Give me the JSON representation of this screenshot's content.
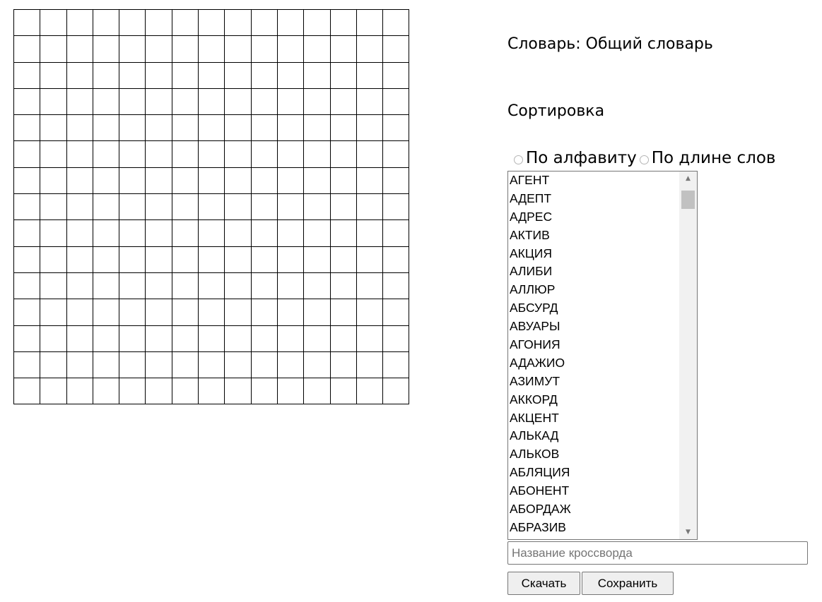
{
  "grid": {
    "rows": 15,
    "cols": 15
  },
  "dictionary": {
    "label": "Словарь: Общий словарь"
  },
  "sorting": {
    "title": "Сортировка",
    "option_alpha": "По алфавиту",
    "option_length": "По длине слов",
    "selected": "none"
  },
  "words": [
    "АГЕНТ",
    "АДЕПТ",
    "АДРЕС",
    "АКТИВ",
    "АКЦИЯ",
    "АЛИБИ",
    "АЛЛЮР",
    "АБСУРД",
    "АВУАРЫ",
    "АГОНИЯ",
    "АДАЖИО",
    "АЗИМУТ",
    "АККОРД",
    "АКЦЕНТ",
    "АЛЬКАД",
    "АЛЬКОВ",
    "АБЛЯЦИЯ",
    "АБОНЕНТ",
    "АБОРДАЖ",
    "АБРАЗИВ"
  ],
  "form": {
    "name_value": "",
    "name_placeholder": "Название кроссворда",
    "download_label": "Скачать",
    "save_label": "Сохранить"
  }
}
